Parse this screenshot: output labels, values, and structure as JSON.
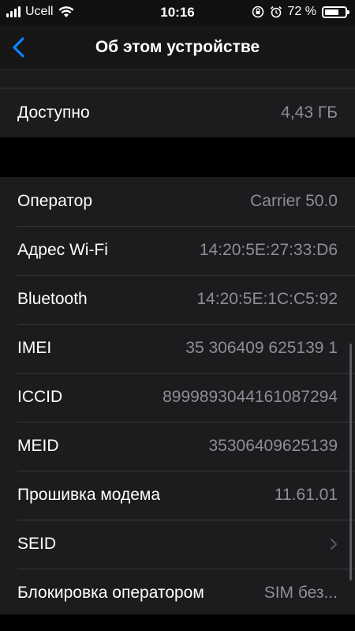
{
  "status_bar": {
    "carrier": "Ucell",
    "time": "10:16",
    "battery_percent_text": "72 %",
    "battery_level": 0.72
  },
  "nav": {
    "title": "Об этом устройстве"
  },
  "capacity_group": [
    {
      "label": "Доступно",
      "value": "4,43 ГБ"
    }
  ],
  "network_group": [
    {
      "label": "Оператор",
      "value": "Carrier 50.0"
    },
    {
      "label": "Адрес Wi-Fi",
      "value": "14:20:5E:27:33:D6"
    },
    {
      "label": "Bluetooth",
      "value": "14:20:5E:1C:C5:92"
    },
    {
      "label": "IMEI",
      "value": "35 306409 625139 1"
    },
    {
      "label": "ICCID",
      "value": "8999893044161087294"
    },
    {
      "label": "MEID",
      "value": "35306409625139"
    },
    {
      "label": "Прошивка модема",
      "value": "11.61.01"
    },
    {
      "label": "SEID",
      "value": ""
    },
    {
      "label": "Блокировка оператором",
      "value": "SIM без..."
    }
  ],
  "colors": {
    "background": "#000000",
    "cell": "#1c1c1e",
    "accent": "#0a84ff",
    "secondary_text": "#8e8e93"
  },
  "icons": {
    "back": "chevron-left-icon",
    "wifi": "wifi-icon",
    "orientation_lock": "orientation-lock-icon",
    "alarm": "alarm-icon",
    "battery": "battery-icon",
    "disclosure": "chevron-right-icon"
  }
}
